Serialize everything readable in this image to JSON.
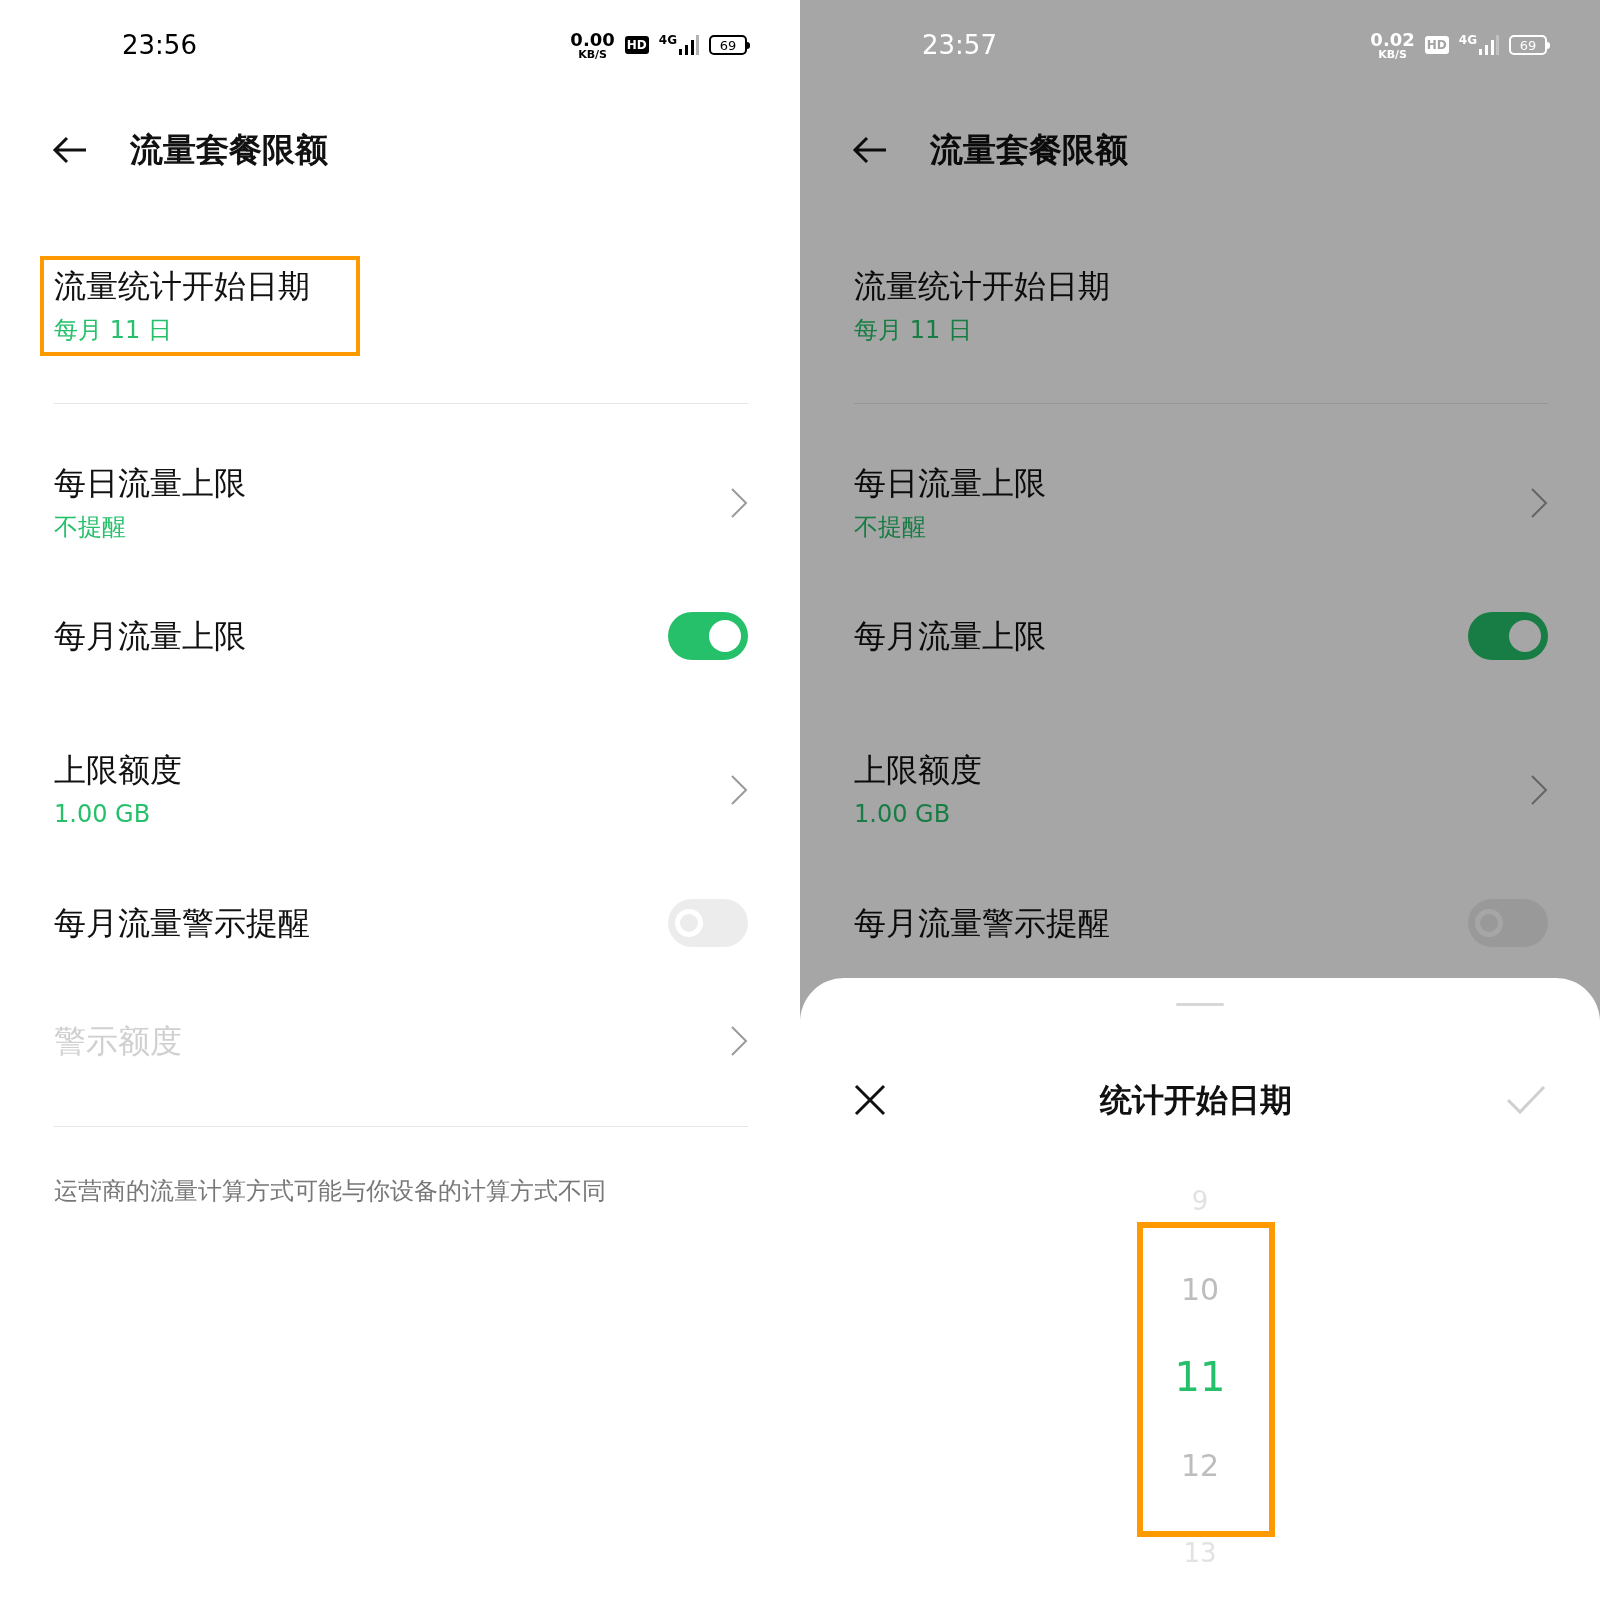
{
  "screens": [
    {
      "status_bar": {
        "time": "23:56",
        "speed": "0.00",
        "speed_unit": "KB/S",
        "hd": "HD",
        "network": "4G",
        "battery": "69"
      },
      "title": "流量套餐限额",
      "rows": [
        {
          "kind": "value",
          "title": "流量统计开始日期",
          "value": "每月 11 日",
          "highlighted": true,
          "disabled": false
        },
        {
          "kind": "nav",
          "title": "每日流量上限",
          "value": "不提醒",
          "disabled": false
        },
        {
          "kind": "toggle",
          "title": "每月流量上限",
          "on": true,
          "disabled": false
        },
        {
          "kind": "nav",
          "title": "上限额度",
          "value": "1.00 GB",
          "disabled": false
        },
        {
          "kind": "toggle",
          "title": "每月流量警示提醒",
          "on": false,
          "disabled": false
        },
        {
          "kind": "nav",
          "title": "警示额度",
          "disabled": true
        }
      ],
      "footnote": "运营商的流量计算方式可能与你设备的计算方式不同"
    },
    {
      "dimmed": true,
      "status_bar": {
        "time": "23:57",
        "speed": "0.02",
        "speed_unit": "KB/S",
        "hd": "HD",
        "network": "4G",
        "battery": "69"
      },
      "title": "流量套餐限额",
      "rows": [
        {
          "kind": "value",
          "title": "流量统计开始日期",
          "value": "每月 11 日",
          "disabled": false
        },
        {
          "kind": "nav",
          "title": "每日流量上限",
          "value": "不提醒",
          "disabled": false
        },
        {
          "kind": "toggle",
          "title": "每月流量上限",
          "on": true,
          "disabled": false
        },
        {
          "kind": "nav",
          "title": "上限额度",
          "value": "1.00 GB",
          "disabled": false
        },
        {
          "kind": "toggle",
          "title": "每月流量警示提醒",
          "on": false,
          "disabled": false
        }
      ],
      "sheet": {
        "title": "统计开始日期",
        "highlighted": true,
        "items": [
          {
            "label": "9",
            "selected": false
          },
          {
            "label": "10",
            "selected": false
          },
          {
            "label": "11",
            "selected": true
          },
          {
            "label": "12",
            "selected": false
          },
          {
            "label": "13",
            "selected": false
          }
        ]
      }
    }
  ]
}
